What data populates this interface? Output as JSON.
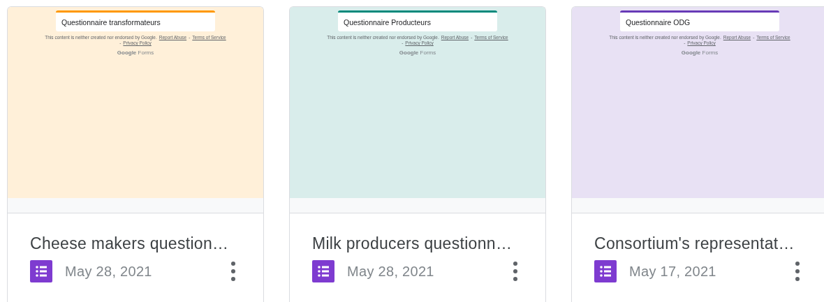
{
  "cards": [
    {
      "preview": {
        "form_title": "Questionnaire transformateurs",
        "color": "#ff9800",
        "notice": "This content is neither created nor endorsed by Google.",
        "links": [
          "Report Abuse",
          "Terms of Service",
          "Privacy Policy"
        ],
        "separator": "-",
        "brand": "Google",
        "product": "Forms"
      },
      "name": "Cheese makers question…",
      "date": "May 28, 2021"
    },
    {
      "preview": {
        "form_title": "Questionnaire Producteurs",
        "color": "#00897b",
        "notice": "This content is neither created nor endorsed by Google.",
        "links": [
          "Report Abuse",
          "Terms of Service",
          "Privacy Policy"
        ],
        "separator": "-",
        "brand": "Google",
        "product": "Forms"
      },
      "name": "Milk producers questionn…",
      "date": "May 28, 2021"
    },
    {
      "preview": {
        "form_title": "Questionnaire ODG",
        "color": "#673ab7",
        "notice": "This content is neither created nor endorsed by Google.",
        "links": [
          "Report Abuse",
          "Terms of Service",
          "Privacy Policy"
        ],
        "separator": "-",
        "brand": "Google",
        "product": "Forms"
      },
      "name": "Consortium's representat…",
      "date": "May 17, 2021"
    }
  ]
}
